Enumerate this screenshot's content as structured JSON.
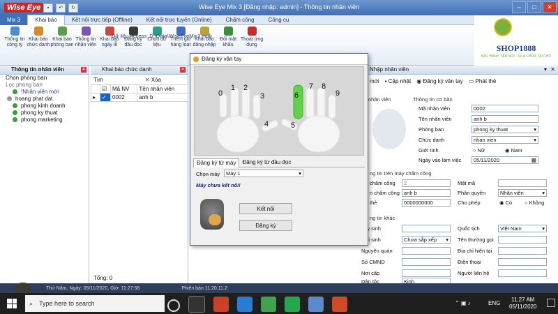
{
  "window": {
    "logo": "Wise Eye",
    "title": "Wise Eye Mix 3 [Đăng nhập: admin] - Thông tin nhân viên"
  },
  "ribbon_tabs": [
    "Mix 3",
    "Khai báo",
    "Kết nối trực tiếp (Offline)",
    "Kết nối trực tuyến (Online)",
    "Chấm công",
    "Công cụ"
  ],
  "ribbon_buttons": [
    {
      "label": "Thông tin công ty",
      "icon": "building-icon",
      "color": "#4a8fd6"
    },
    {
      "label": "Khai báo chức danh",
      "icon": "people-icon",
      "color": "#d38b2a"
    },
    {
      "label": "Khai báo phòng ban",
      "icon": "department-icon",
      "color": "#5aa04a"
    },
    {
      "label": "Thông tin nhân viên",
      "icon": "employee-icon",
      "color": "#7b55b3"
    },
    {
      "label": "Khai báo ngày lễ",
      "icon": "calendar-icon",
      "color": "#c44a3a"
    },
    {
      "label": "Đăng ký đầu đọc",
      "icon": "reader-icon",
      "color": "#3a3a3a"
    },
    {
      "label": "Chọn dữ liệu",
      "icon": "database-icon",
      "color": "#2a9e8a"
    },
    {
      "label": "Thêm giờ hàng loạt",
      "icon": "clock-icon",
      "color": "#3e6fc4"
    },
    {
      "label": "Khai báo đăng nhập",
      "icon": "login-icon",
      "color": "#c0a030"
    },
    {
      "label": "Đổi mật khẩu",
      "icon": "key-icon",
      "color": "#3b8c3b"
    },
    {
      "label": "Thoát ứng dụng",
      "icon": "exit-icon",
      "color": "#c92a2a"
    }
  ],
  "ribbon_path": "Dữ liệu Access: D:\\Data\\WiseEyeMix3.mdb",
  "shop": {
    "name": "SHOP1888",
    "tagline": "BẢO HÀNH TẬN NƠI - SỬA CHỮA TẠI CHỖ"
  },
  "left_panel": {
    "tab": "Thông tin nhân viên",
    "choose_dept": "Chọn phòng ban",
    "filter_dept": "Lọc phòng ban",
    "tree": [
      "!Nhân viên mới",
      "hoang phat dat",
      "phong kinh doanh",
      "phong ky thuat",
      "phong marketing"
    ]
  },
  "mid_panel": {
    "tab": "Khai báo chức danh",
    "search_label": "Tìm",
    "delete_label": "Xóa",
    "col_id": "Mã NV",
    "col_name": "Tên nhân viên",
    "row_id": "0002",
    "row_name": "anh b",
    "total": "Tổng:  0"
  },
  "right_panel": {
    "tab": "Nhập nhân viên",
    "toolbar": [
      "mới",
      "Cập nhật",
      "Đăng ký vân tay",
      "Phát thẻ"
    ],
    "photo_label": "nhân viên",
    "basic_info": "Thông tin cơ bản",
    "ma_nv_label": "Mã nhân viên",
    "ma_nv": "0002",
    "ten_nv_label": "Tên nhân viên",
    "ten_nv": "anh b",
    "phong_label": "Phòng ban",
    "phong": "phong ky thuat",
    "chuc_danh_label": "Chức danh",
    "chuc_danh": "nhan vien",
    "gioi_tinh_label": "Giới tính",
    "nu": "Nữ",
    "nam": "Nam",
    "ngay_vao_label": "Ngày vào làm việc",
    "ngay_vao": "05/11/2020",
    "machine_info": "ng tin trên máy chấm công",
    "cham_cong_label": "chấm công",
    "cham_cong": "2",
    "mat_ma_label": "Mật mã",
    "ten_cham_cong_label": "n chấm công",
    "ten_cham_cong": "anh b",
    "phan_quyen_label": "Phân quyền",
    "phan_quyen": "Nhân viên",
    "the_label": "thẻ",
    "the": "0000000000",
    "cho_phep_label": "Cho phép",
    "co": "Có",
    "khong": "Không",
    "other_info": "ng tin khác",
    "ngay_sinh_label": "gày sinh",
    "quoc_tich_label": "Quốc tịch",
    "quoc_tich": "Việt Nam",
    "noi_sinh_label": "Nơi sinh",
    "noi_sinh": "Chưa sắp xếp",
    "ten_thuong_goi_label": "Tên thường gọi",
    "nguyen_quan_label": "Nguyên quán",
    "dia_chi_label": "Địa chỉ hiện tại",
    "so_cmnd_label": "Số CMND",
    "dien_thoai_label": "Điện thoại",
    "noi_cap_label": "Nơi cấp",
    "nguoi_lien_he_label": "Người liên hệ",
    "dan_toc_label": "Dân tộc",
    "dan_toc": "Kinh"
  },
  "modal": {
    "title": "Đăng ký vân tay",
    "fingers": [
      "0",
      "1",
      "2",
      "3",
      "4",
      "5",
      "6",
      "7",
      "8",
      "9"
    ],
    "tab_machine": "Đăng ký từ máy",
    "tab_reader": "Đăng ký từ đầu đọc",
    "choose_machine_label": "Chọn máy",
    "machine": "Máy 1",
    "status": "Máy chưa kết nối!",
    "connect": "Kết nối",
    "register": "Đăng ký",
    "highlight_color": "#5fd24a"
  },
  "status_bar": {
    "date": "Thứ Năm, Ngày: 05/11/2020,  Giờ: 11:27:58",
    "version": "Phiên bản 11.20.11.2"
  },
  "taskbar": {
    "search": "Type here to search",
    "time": "11:27 AM",
    "date": "05/11/2020",
    "lang": "ENG"
  }
}
